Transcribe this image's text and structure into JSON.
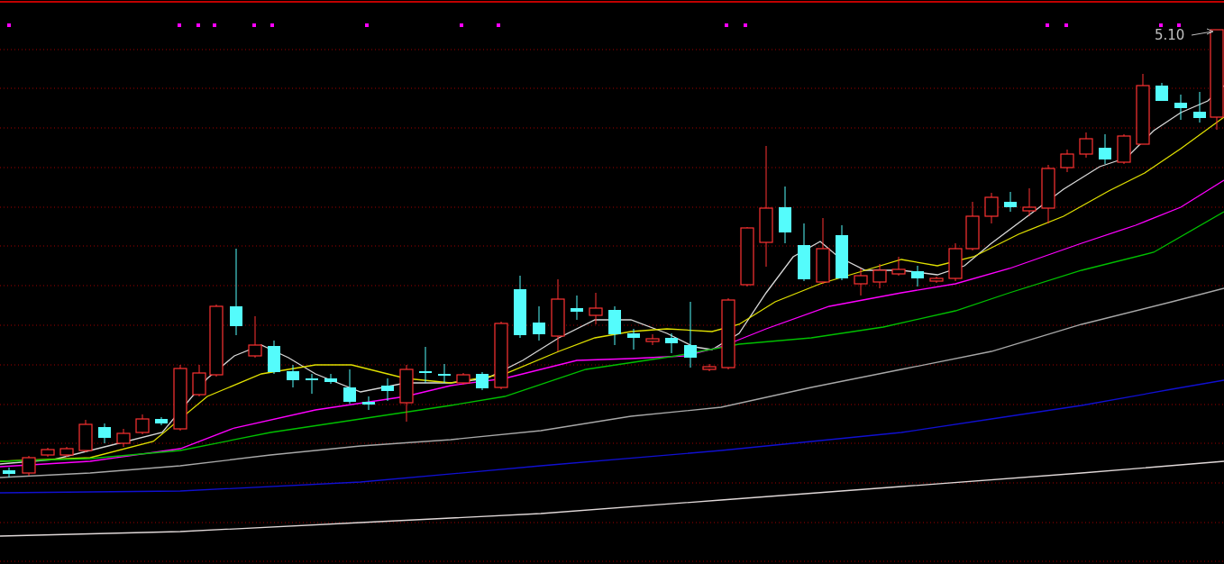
{
  "chart": {
    "high_price_label": "5.10"
  }
}
